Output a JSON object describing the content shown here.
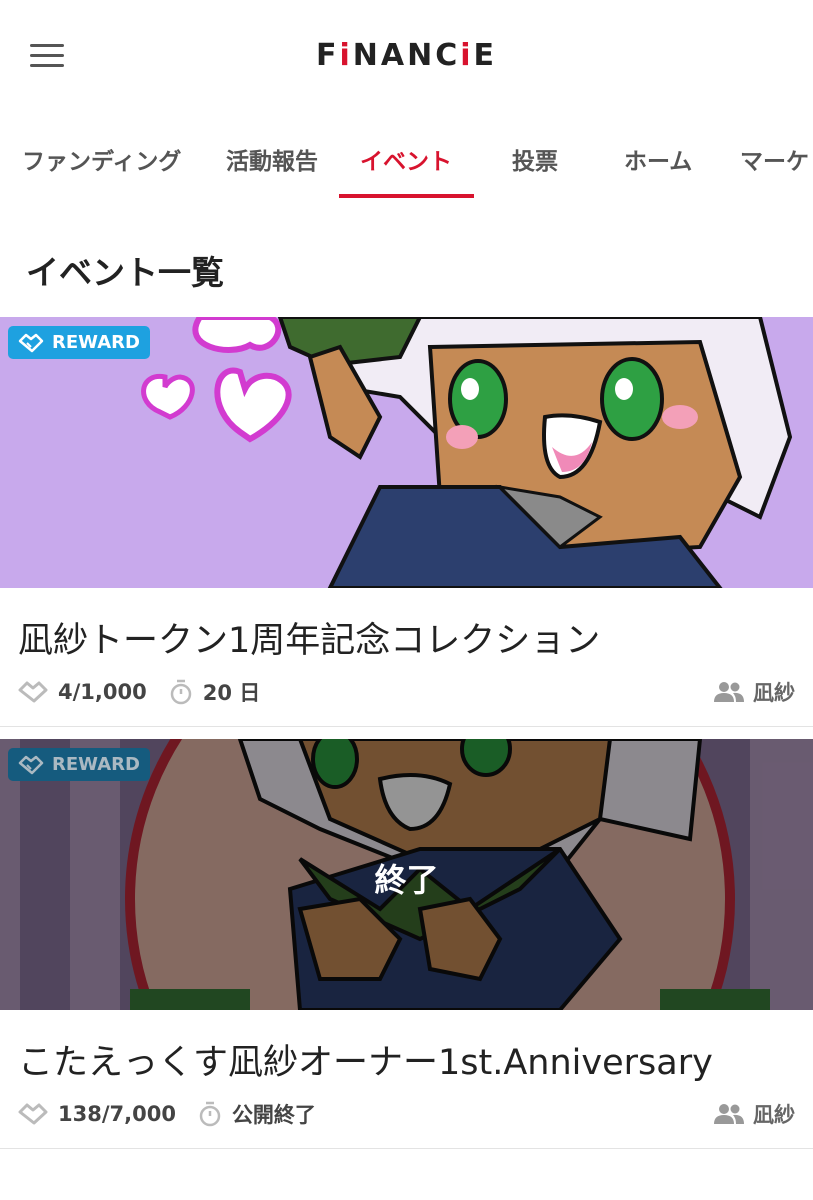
{
  "header": {
    "logo_text": "FiNANCiE",
    "menu_icon": "hamburger-menu-icon"
  },
  "tabs": [
    {
      "label": "ファンディング",
      "active": false
    },
    {
      "label": "活動報告",
      "active": false
    },
    {
      "label": "イベント",
      "active": true
    },
    {
      "label": "投票",
      "active": false
    },
    {
      "label": "ホーム",
      "active": false
    },
    {
      "label": "マーケ",
      "active": false
    }
  ],
  "section": {
    "title": "イベント一覧"
  },
  "events": [
    {
      "badge": "REWARD",
      "title": "凪紗トークン1周年記念コレクション",
      "count": "4/1,000",
      "time": "20 日",
      "owner": "凪紗",
      "ended": false
    },
    {
      "badge": "REWARD",
      "title": "こたえっくす凪紗オーナー1st.Anniversary",
      "count": "138/7,000",
      "time": "公開終了",
      "owner": "凪紗",
      "ended": true,
      "ended_label": "終了"
    }
  ],
  "colors": {
    "accent": "#d8132e",
    "badge": "#1ea1e0",
    "banner1_bg": "#c8a9ec",
    "banner2_bg": "#6e5a7a"
  }
}
